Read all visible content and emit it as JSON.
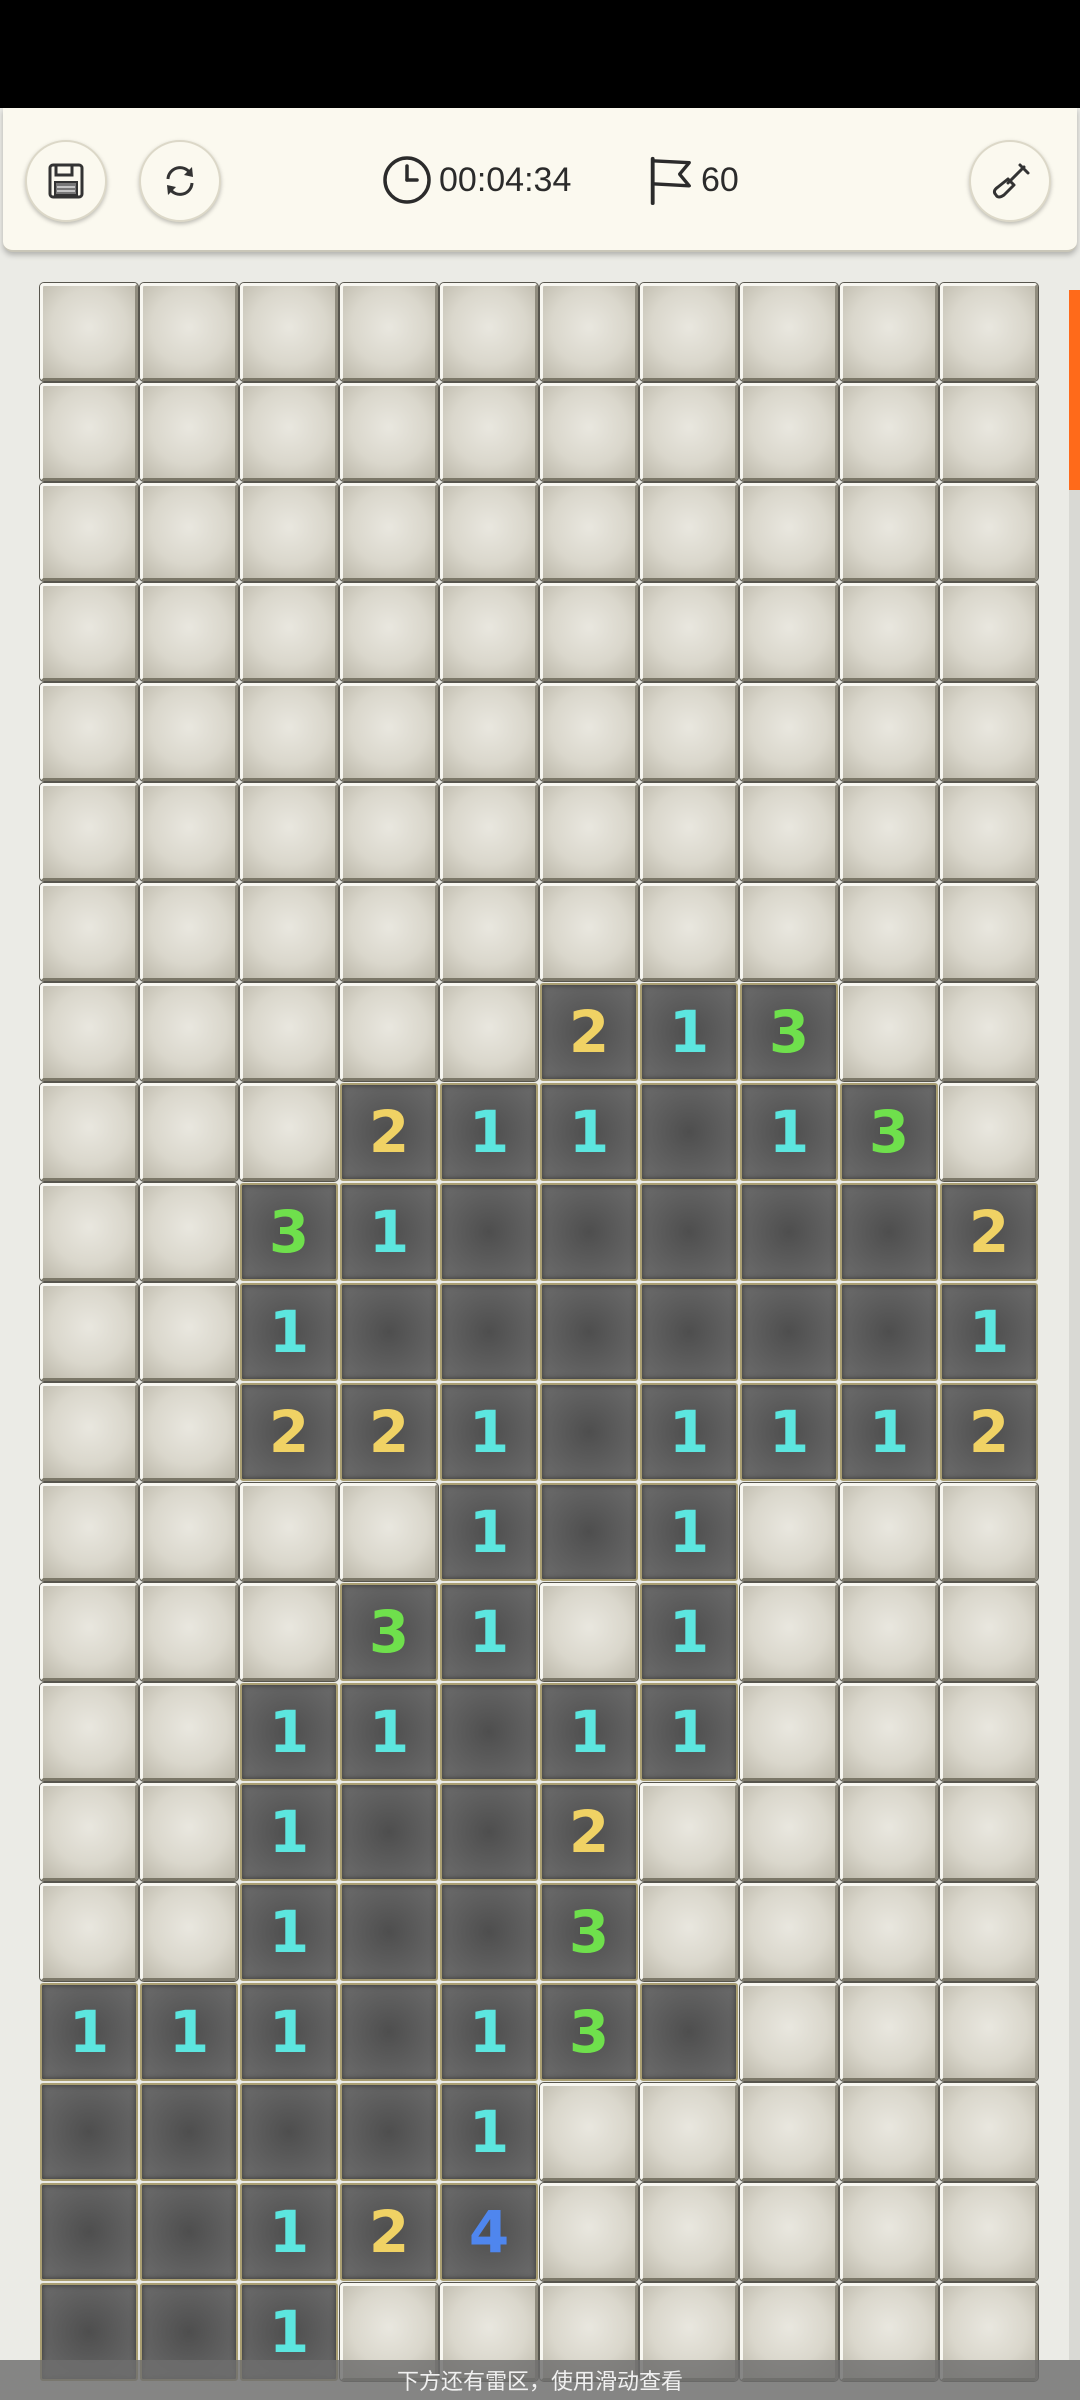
{
  "toolbar": {
    "timer": "00:04:34",
    "flags": "60",
    "icons": {
      "save": "floppy-disk-icon",
      "restart": "refresh-icon",
      "clock": "clock-icon",
      "flag": "flag-icon",
      "mode": "shovel-icon"
    }
  },
  "board": {
    "cols": 10,
    "visible_rows": 21,
    "legend": {
      "#": "closed tile",
      "0": "opened empty tile",
      "1-8": "opened tile showing adjacent mine count"
    },
    "rows": [
      "##########",
      "##########",
      "##########",
      "##########",
      "##########",
      "##########",
      "##########",
      "#####213##",
      "###211013#",
      "##31000002",
      "##10000001",
      "##22101112",
      "####101###",
      "###31#1###",
      "##11011###",
      "##1002####",
      "##1003####",
      "1110130###",
      "00001#####",
      "00124#####",
      "001#######"
    ],
    "number_colors": {
      "1": "#5ce6df",
      "2": "#f0d264",
      "3": "#6fe04c",
      "4": "#4f86ee"
    }
  },
  "hint": "下方还有雷区，使用滑动查看",
  "colors": {
    "accent": "#ff6a1a",
    "toolbar_bg": "#fbf9ef"
  }
}
